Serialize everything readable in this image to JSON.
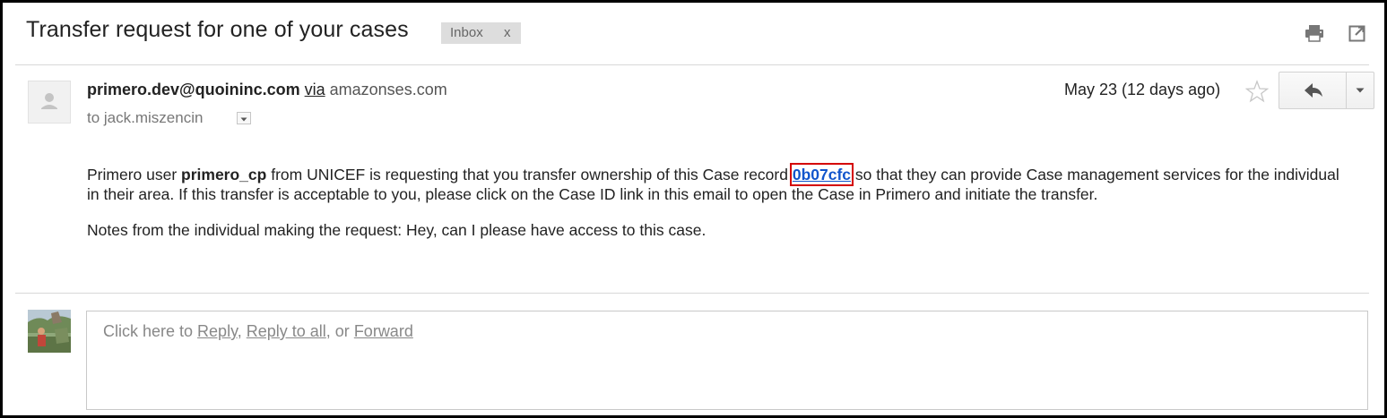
{
  "email": {
    "subject": "Transfer request for one of your cases",
    "label": "Inbox",
    "label_remove": "x",
    "sender_name": "primero.dev@quoininc.com",
    "via": "via",
    "via_domain": "amazonses.com",
    "recipient": "to jack.miszencin",
    "date": "May 23 (12 days ago)",
    "body": {
      "p1_part1": "Primero user ",
      "p1_user": "primero_cp",
      "p1_part2": " from UNICEF is requesting that you transfer ownership of this Case record ",
      "case_id": "0b07cfc",
      "p1_part3": " so that they can provide Case management services for the individual in their area. If this transfer is acceptable to you, please click on the Case ID link in this email to open the Case in Primero and initiate the transfer.",
      "notes": "Notes from the individual making the request: Hey, can I please have access to this case."
    }
  },
  "reply": {
    "prefix": "Click here to ",
    "reply": "Reply",
    "sep1": ", ",
    "reply_all": "Reply to all",
    "sep2": ", or ",
    "forward": "Forward"
  },
  "icons": {
    "print": "print-icon",
    "popout": "popout-icon",
    "star": "star-icon",
    "reply": "reply-arrow-icon",
    "more": "chevron-down-icon",
    "dropdown": "caret-down-icon",
    "avatar": "person-icon"
  },
  "colors": {
    "link": "#1155cc",
    "highlight_box": "#d40000",
    "label_bg": "#dddddd"
  }
}
